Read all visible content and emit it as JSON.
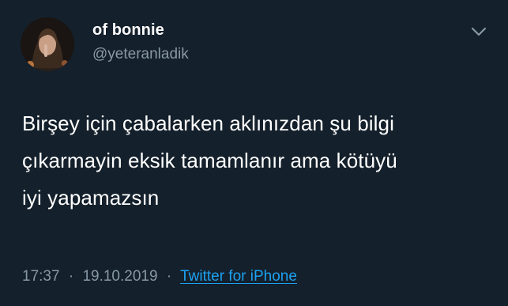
{
  "author": {
    "display_name": "of bonnie",
    "handle": "@yeteranladik"
  },
  "tweet": {
    "lines": [
      "Birşey için çabalarken aklınızdan şu bilgi",
      "çıkarmayin eksik tamamlanır ama kötüyü",
      "iyi yapamazsın"
    ]
  },
  "meta": {
    "time": "17:37",
    "separator": "·",
    "date": "19.10.2019",
    "source": "Twitter for iPhone"
  },
  "icons": {
    "menu": "chevron-down-icon",
    "avatar": "profile-photo"
  },
  "colors": {
    "background": "#15202b",
    "secondary_text": "#8899a6",
    "link": "#1da1f2"
  }
}
